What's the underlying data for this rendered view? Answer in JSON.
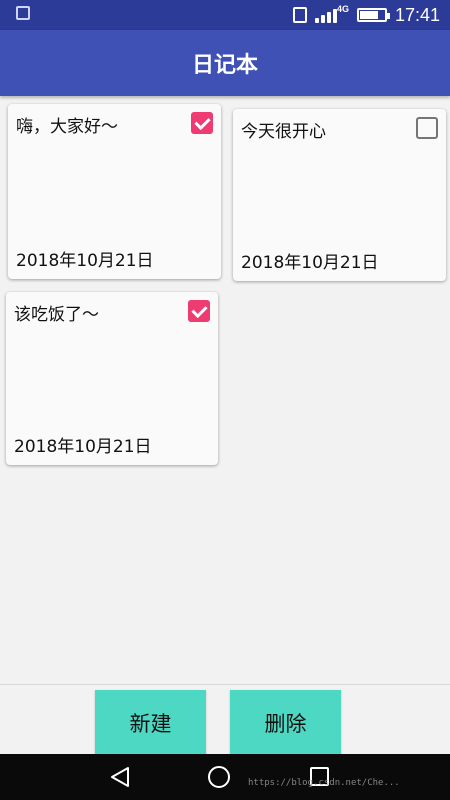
{
  "status_bar": {
    "network": "4G",
    "time": "17:41",
    "battery_level": 0.75
  },
  "app_bar": {
    "title": "日记本"
  },
  "notes": [
    {
      "text": "嗨，大家好～",
      "date": "2018年10月21日",
      "checked": true
    },
    {
      "text": "今天很开心",
      "date": "2018年10月21日",
      "checked": false
    },
    {
      "text": "该吃饭了～",
      "date": "2018年10月21日",
      "checked": true
    }
  ],
  "actions": {
    "new_label": "新建",
    "delete_label": "删除"
  },
  "watermark": "https://blog.csdn.net/Che...",
  "colors": {
    "status_bar": "#2c3a98",
    "app_bar": "#3f51b5",
    "checkbox_checked": "#ee3b72",
    "action_button": "#4dd8c4"
  },
  "icons": {
    "nav": [
      "back-icon",
      "home-icon",
      "recent-apps-icon"
    ],
    "status": [
      "gallery-notification-icon",
      "vibrate-icon",
      "signal-icon",
      "battery-icon"
    ]
  }
}
